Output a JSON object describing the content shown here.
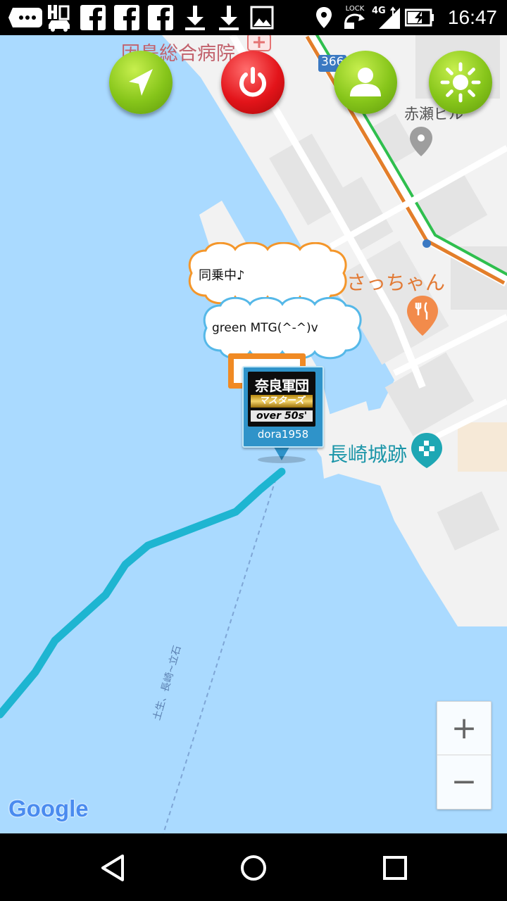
{
  "status_bar": {
    "time": "16:47",
    "lock_label": "LOCK",
    "network_label": "4G",
    "icons": [
      "chat-bubble-icon",
      "carrier-icon",
      "facebook-icon",
      "facebook-icon",
      "facebook-icon",
      "download-icon",
      "download-icon",
      "image-icon",
      "location-icon",
      "rotation-lock-icon",
      "signal-icon",
      "battery-charging-icon"
    ]
  },
  "toolbar": {
    "buttons": [
      {
        "name": "navigate",
        "icon": "navigation-arrow-icon",
        "color": "#86c51a"
      },
      {
        "name": "power",
        "icon": "power-icon",
        "color": "#e3141a"
      },
      {
        "name": "profile",
        "icon": "person-icon",
        "color": "#86c51a"
      },
      {
        "name": "brightness",
        "icon": "sun-icon",
        "color": "#86c51a"
      }
    ]
  },
  "map": {
    "labels": {
      "hospital": "因島総合病院",
      "route_number": "366",
      "building": "赤瀬ビル",
      "restaurant": "さっちゃん",
      "castle": "長崎城跡",
      "ferry_route": "土生、長崎~立石"
    },
    "google_logo": "Google",
    "zoom_in": "+",
    "zoom_out": "−",
    "colors": {
      "water": "#aadaff",
      "land": "#f2f2f2",
      "track": "#1eb5d1",
      "restaurant_pin": "#f28b4b",
      "castle_pin": "#1ea7b4"
    }
  },
  "speech_bubbles": [
    {
      "text": "同乗中♪",
      "border": "#f4962a"
    },
    {
      "text": "green MTG(^-^)v",
      "border": "#55b8e8"
    }
  ],
  "user_marker": {
    "line1": "奈良軍団",
    "line2": "マスターズ",
    "line3": "over 50s'",
    "username": "dora1958"
  },
  "nav_bar": {
    "icons": [
      "back-icon",
      "home-icon",
      "recents-icon"
    ]
  }
}
